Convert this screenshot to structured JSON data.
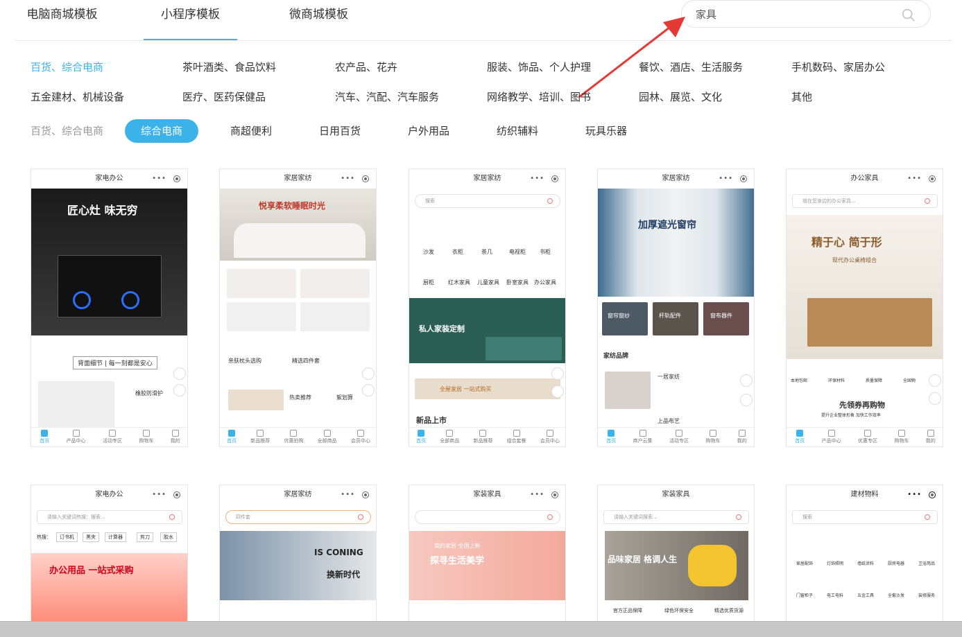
{
  "tabs": [
    {
      "label": "电脑商城模板"
    },
    {
      "label": "小程序模板"
    },
    {
      "label": "微商城模板"
    }
  ],
  "search": {
    "value": "家具",
    "icon": "search-icon"
  },
  "categories": [
    "百货、综合电商",
    "茶叶酒类、食品饮料",
    "农产品、花卉",
    "服装、饰品、个人护理",
    "餐饮、酒店、生活服务",
    "手机数码、家居办公",
    "五金建材、机械设备",
    "医疗、医药保健品",
    "汽车、汽配、汽车服务",
    "网络教学、培训、图书",
    "园林、展览、文化",
    "其他"
  ],
  "subcategories": [
    "百货、综合电商",
    "综合电商",
    "商超便利",
    "日用百货",
    "户外用品",
    "纺织辅料",
    "玩具乐器"
  ],
  "accent": "#3bb3e8",
  "cards": [
    {
      "title": "家电办公",
      "t1": "匠心灶 味无穷",
      "t2": "背面细节 | 每一刻都是安心",
      "t3": "橡胶防滑护",
      "foot": [
        "首页",
        "产品中心",
        "活动专区",
        "购物车",
        "我的"
      ]
    },
    {
      "title": "家居家纺",
      "t1": "悦享柔软睡眠时光",
      "t2": "亲肤枕头选购",
      "t3": "精选四件套",
      "t4": "热卖推荐",
      "t5": "絮划算",
      "foot": [
        "首页",
        "新品推荐",
        "优惠拍购",
        "全部商品",
        "会员中心"
      ]
    },
    {
      "title": "家居家纺",
      "search": "搜索",
      "icons": [
        "沙发",
        "衣柜",
        "茶几",
        "电视柜",
        "书柜",
        "厨柜",
        "红木家具",
        "儿童家具",
        "卧室家具",
        "办公家具"
      ],
      "t1": "私人家装定制",
      "t2": "全屋家居 一站式购买",
      "t3": "新品上市",
      "foot": [
        "首页",
        "全部商品",
        "新品推荐",
        "组合套餐",
        "会员中心"
      ]
    },
    {
      "title": "家居家纺",
      "t1": "加厚遮光窗帘",
      "tags": [
        "窗帘窗纱",
        "杆轨配件",
        "窗布器件"
      ],
      "t2": "家纺品牌",
      "t3": "一居家纺",
      "t4": "上品布艺",
      "foot": [
        "首页",
        "商户云集",
        "活动专区",
        "购物车",
        "我的"
      ]
    },
    {
      "title": "办公家具",
      "search": "就在您身边的办公家具...",
      "t1": "精于心 简于形",
      "t2": "现代办公桌椅组合",
      "icons": [
        "本地包邮",
        "环保材料",
        "质量保障",
        "全国物"
      ],
      "t3": "先领券再购物",
      "t4": "提升企业整体形象 加快工作效率",
      "foot": [
        "首页",
        "产品中心",
        "优惠专区",
        "购物车",
        "我的"
      ]
    },
    {
      "title": "家电办公",
      "search": "请输入关键词热搜：搜索...",
      "hot": [
        "热搜：",
        "订书机",
        "黑夹",
        "计算器",
        "剪刀",
        "胶水"
      ],
      "t1": "办公用品 一站式采购"
    },
    {
      "title": "家居家纺",
      "search": "四件套",
      "t1": "IS CONING",
      "t2": "换新时代"
    },
    {
      "title": "家装家具",
      "t1": "探寻生活美学",
      "t2": "简约家居·全国上新"
    },
    {
      "title": "家装家具",
      "search": "请输入关键词搜索...",
      "t1": "品味家居 格调人生",
      "tags": [
        "官方正品保障",
        "绿色环保安全",
        "精选优质货源"
      ]
    },
    {
      "title": "建材物料",
      "search": "搜索",
      "icons": [
        "家居配饰",
        "灯饰照明",
        "墙纸涂料",
        "厨房电器",
        "卫浴用品",
        "门窗柜子",
        "电工电料",
        "五金工具",
        "全套沙发",
        "装修服务"
      ]
    }
  ]
}
